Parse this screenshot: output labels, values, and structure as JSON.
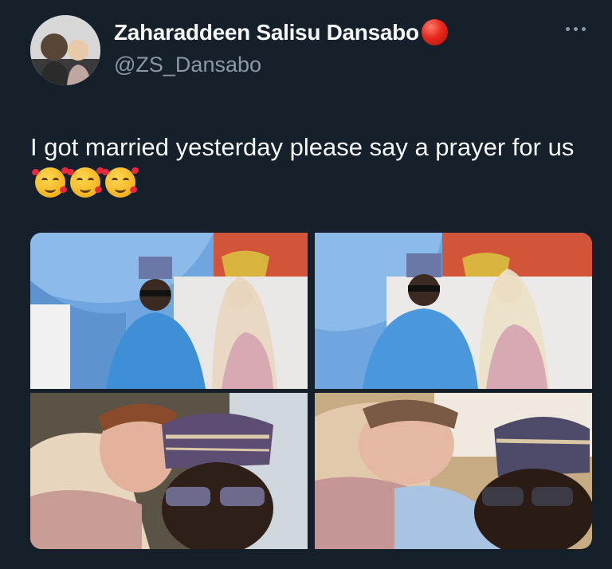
{
  "tweet": {
    "author": {
      "display_name": "Zaharaddeen Salisu Dansabo",
      "handle": "@ZS_Dansabo",
      "status_emoji": "red-circle"
    },
    "text": "I got married yesterday please say a prayer for us",
    "emojis": [
      "smiling-face-with-hearts",
      "smiling-face-with-hearts",
      "smiling-face-with-hearts"
    ],
    "media_count": 4
  },
  "icons": {
    "more": "more-horizontal-icon"
  },
  "colors": {
    "background": "#15202b",
    "primary_text": "#f7f9f9",
    "secondary_text": "#8b98a5",
    "status_dot": "#e8281c"
  }
}
